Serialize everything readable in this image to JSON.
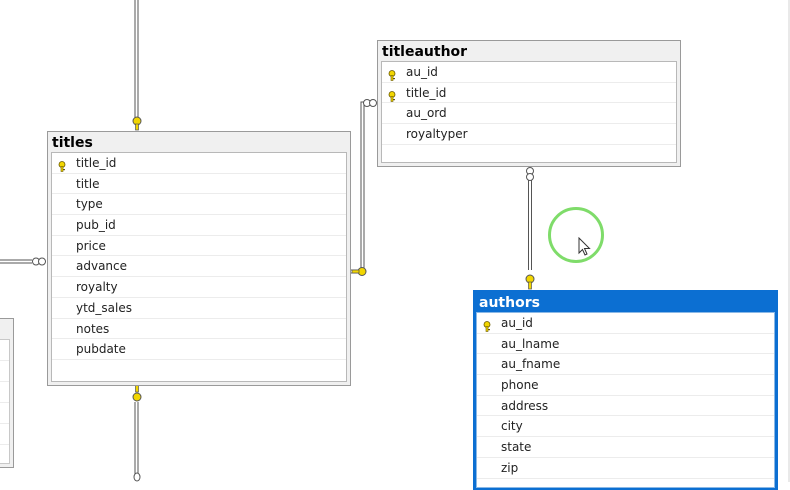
{
  "tables": [
    {
      "id": "titles",
      "name": "titles",
      "selected": false,
      "columns": [
        {
          "name": "title_id",
          "pk": true
        },
        {
          "name": "title",
          "pk": false
        },
        {
          "name": "type",
          "pk": false
        },
        {
          "name": "pub_id",
          "pk": false
        },
        {
          "name": "price",
          "pk": false
        },
        {
          "name": "advance",
          "pk": false
        },
        {
          "name": "royalty",
          "pk": false
        },
        {
          "name": "ytd_sales",
          "pk": false
        },
        {
          "name": "notes",
          "pk": false
        },
        {
          "name": "pubdate",
          "pk": false
        }
      ]
    },
    {
      "id": "titleauthor",
      "name": "titleauthor",
      "selected": false,
      "columns": [
        {
          "name": "au_id",
          "pk": true
        },
        {
          "name": "title_id",
          "pk": true
        },
        {
          "name": "au_ord",
          "pk": false
        },
        {
          "name": "royaltyper",
          "pk": false
        }
      ]
    },
    {
      "id": "authors",
      "name": "authors",
      "selected": true,
      "columns": [
        {
          "name": "au_id",
          "pk": true
        },
        {
          "name": "au_lname",
          "pk": false
        },
        {
          "name": "au_fname",
          "pk": false
        },
        {
          "name": "phone",
          "pk": false
        },
        {
          "name": "address",
          "pk": false
        },
        {
          "name": "city",
          "pk": false
        },
        {
          "name": "state",
          "pk": false
        },
        {
          "name": "zip",
          "pk": false
        }
      ]
    }
  ],
  "relationships": [
    {
      "from": "titles",
      "to": "titleauthor"
    },
    {
      "from": "authors",
      "to": "titleauthor"
    }
  ],
  "colors": {
    "selection": "#0c6fd2",
    "key": "#f2d600",
    "cursor_ring": "#7fdc6a"
  }
}
